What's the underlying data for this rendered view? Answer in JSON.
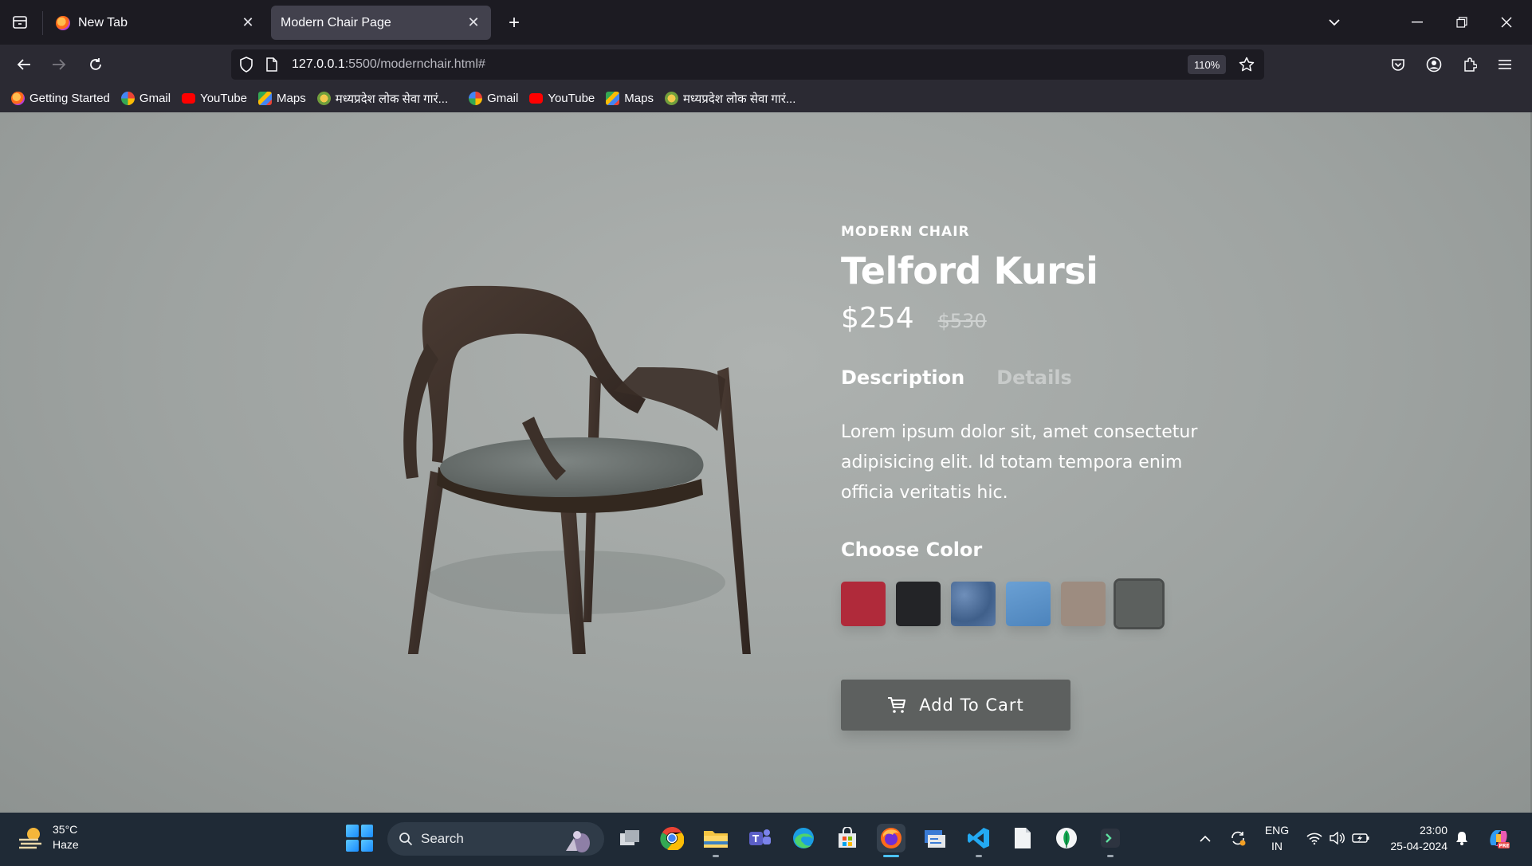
{
  "browser": {
    "tabs": [
      {
        "title": "New Tab",
        "active": false
      },
      {
        "title": "Modern Chair Page",
        "active": true
      }
    ],
    "url": {
      "host": "127.0.0.1",
      "rest": ":5500/modernchair.html#"
    },
    "zoom": "110%",
    "bookmarks": [
      {
        "label": "Getting Started",
        "icon": "firefox-icon"
      },
      {
        "label": "Gmail",
        "icon": "google-icon"
      },
      {
        "label": "YouTube",
        "icon": "youtube-icon"
      },
      {
        "label": "Maps",
        "icon": "maps-icon"
      },
      {
        "label": "मध्यप्रदेश लोक सेवा गारं...",
        "icon": "mp-emblem-icon"
      },
      {
        "label": "Gmail",
        "icon": "google-icon"
      },
      {
        "label": "YouTube",
        "icon": "youtube-icon"
      },
      {
        "label": "Maps",
        "icon": "maps-icon"
      },
      {
        "label": "मध्यप्रदेश लोक सेवा गारं...",
        "icon": "mp-emblem-icon"
      }
    ]
  },
  "product": {
    "eyebrow": "MODERN CHAIR",
    "name": "Telford Kursi",
    "price": "$254",
    "old_price": "$530",
    "tabs": [
      {
        "label": "Description",
        "active": true
      },
      {
        "label": "Details",
        "active": false
      }
    ],
    "description": "Lorem ipsum dolor sit, amet consectetur adipisicing elit. Id totam tempora enim officia veritatis hic.",
    "choose_color_label": "Choose Color",
    "colors": [
      {
        "name": "red",
        "hex": "#b02a3a"
      },
      {
        "name": "black",
        "hex": "#232427"
      },
      {
        "name": "denim",
        "hex": "#4f6f9a"
      },
      {
        "name": "light-blue",
        "hex": "#5a90c6"
      },
      {
        "name": "beige",
        "hex": "#9d8c80"
      },
      {
        "name": "grey",
        "hex": "#5c605e",
        "selected": true
      }
    ],
    "add_to_cart_label": "Add To Cart"
  },
  "taskbar": {
    "weather": {
      "temp": "35°C",
      "condition": "Haze"
    },
    "search_placeholder": "Search",
    "language": {
      "line1": "ENG",
      "line2": "IN"
    },
    "clock": {
      "time": "23:00",
      "date": "25-04-2024"
    }
  },
  "colors": {
    "page_bg": "#a3a7a5",
    "button_bg": "#5d605f",
    "chrome_bg": "#1c1b22"
  }
}
